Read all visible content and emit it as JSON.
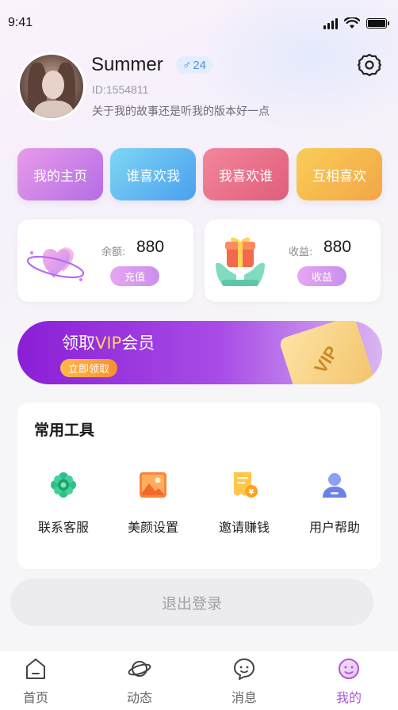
{
  "status_bar": {
    "time": "9:41"
  },
  "profile": {
    "username": "Summer",
    "gender_symbol": "♂",
    "age": "24",
    "user_id": "ID:1554811",
    "bio": "关于我的故事还是听我的版本好一点"
  },
  "quick_actions": [
    {
      "label": "我的主页"
    },
    {
      "label": "谁喜欢我"
    },
    {
      "label": "我喜欢谁"
    },
    {
      "label": "互相喜欢"
    }
  ],
  "wallet": {
    "balance_label": "余额:",
    "balance_value": "880",
    "recharge_label": "充值",
    "income_label": "收益:",
    "income_value": "880",
    "income_button_label": "收益"
  },
  "vip_banner": {
    "title_prefix": "领取",
    "title_accent": "VIP",
    "title_suffix": "会员",
    "button_label": "立即领取",
    "card_text": "VIP"
  },
  "tools": {
    "title": "常用工具",
    "items": [
      {
        "label": "联系客服",
        "icon": "customer-service-icon"
      },
      {
        "label": "美颜设置",
        "icon": "picture-icon"
      },
      {
        "label": "邀请赚钱",
        "icon": "invoice-money-icon"
      },
      {
        "label": "用户帮助",
        "icon": "user-help-icon"
      }
    ]
  },
  "logout_label": "退出登录",
  "tab_bar": [
    {
      "label": "首页",
      "icon": "home-icon"
    },
    {
      "label": "动态",
      "icon": "planet-icon"
    },
    {
      "label": "消息",
      "icon": "chat-icon"
    },
    {
      "label": "我的",
      "icon": "profile-face-icon",
      "active": true
    }
  ],
  "colors": {
    "accent": "#b157d9",
    "vip_purple": "#8a1fd6",
    "vip_gold": "#ffcf62",
    "badge_blue": "#4f8fe8"
  }
}
